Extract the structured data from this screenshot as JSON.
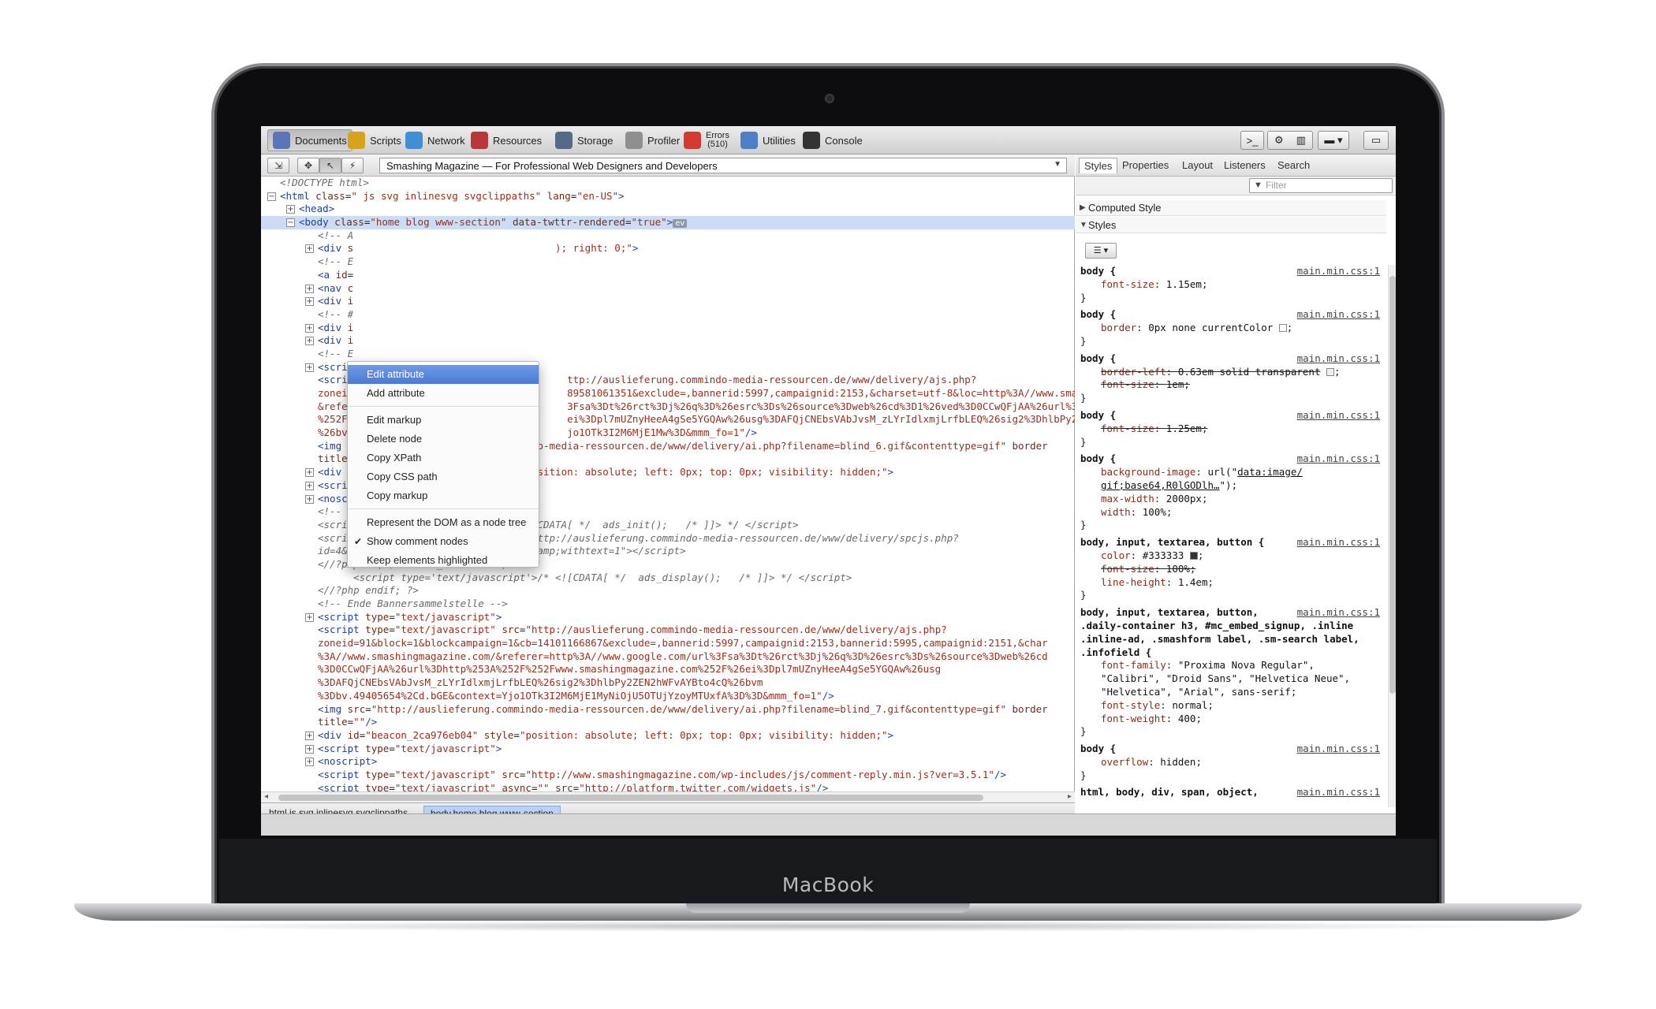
{
  "device": {
    "brand_label": "MacBook"
  },
  "toolbar": {
    "items": [
      {
        "label": "Documents",
        "icon": "documents-icon",
        "color": "#5b76b8"
      },
      {
        "label": "Scripts",
        "icon": "scripts-icon",
        "color": "#d9a21d"
      },
      {
        "label": "Network",
        "icon": "network-icon",
        "color": "#3f8fd6"
      },
      {
        "label": "Resources",
        "icon": "resources-icon",
        "color": "#b9373a"
      },
      {
        "label": "Storage",
        "icon": "storage-icon",
        "color": "#556b85"
      },
      {
        "label": "Profiler",
        "icon": "profiler-icon",
        "color": "#8f8f8f"
      },
      {
        "label": "Errors",
        "icon": "errors-icon",
        "color": "#d23b2e",
        "count": "(510)"
      },
      {
        "label": "Utilities",
        "icon": "utilities-icon",
        "color": "#4d7fc7"
      },
      {
        "label": "Console",
        "icon": "console-icon",
        "color": "#333333"
      }
    ],
    "right_buttons": [
      "console-prompt-icon",
      "gear-icon",
      "panel-dock-icon",
      "window-menu-icon",
      "layout-icon"
    ]
  },
  "subbar": {
    "document_title": "Smashing Magazine — For Professional Web Designers and Developers"
  },
  "context_menu": {
    "items": [
      {
        "label": "Edit attribute",
        "highlighted": true
      },
      {
        "label": "Add attribute"
      },
      {
        "separator": true
      },
      {
        "label": "Edit markup"
      },
      {
        "label": "Delete node"
      },
      {
        "label": "Copy XPath"
      },
      {
        "label": "Copy CSS path"
      },
      {
        "label": "Copy markup"
      },
      {
        "separator": true
      },
      {
        "label": "Represent the DOM as a node tree"
      },
      {
        "label": "Show comment nodes",
        "checked": true
      },
      {
        "label": "Keep elements highlighted"
      }
    ]
  },
  "dom_lines": [
    {
      "indent": 0,
      "toggle": "",
      "html": "<span class=\"cm\">&lt;!DOCTYPE html&gt;</span>"
    },
    {
      "indent": 0,
      "toggle": "−",
      "html": "<span class=\"tag\">&lt;html</span> <span class=\"attr\">class</span>=<span class=\"val\">\" js svg inlinesvg svgclippaths\"</span> <span class=\"attr\">lang</span>=<span class=\"val\">\"en-US\"</span><span class=\"tag\">&gt;</span>"
    },
    {
      "indent": 1,
      "toggle": "+",
      "html": "<span class=\"tag\">&lt;head&gt;</span>"
    },
    {
      "indent": 1,
      "toggle": "−",
      "sel": true,
      "html": "<span class=\"tag\">&lt;body</span> <span class=\"attr\">class</span>=<span class=\"val\">\"home blog www-section\"</span> <span class=\"attr\">data-twttr-rendered</span>=<span class=\"val\">\"true\"</span><span class=\"tag\">&gt;</span><span class=\"ev\">ev</span>"
    },
    {
      "indent": 2,
      "toggle": "",
      "html": "<span class=\"cm\">&lt;!-- A</span>"
    },
    {
      "indent": 2,
      "toggle": "+",
      "html": "<span class=\"tag\">&lt;div</span> <span class=\"attr\">s</span>                                  <span class=\"val\">); right: 0;\"</span><span class=\"tag\">&gt;</span>"
    },
    {
      "indent": 2,
      "toggle": "",
      "html": "<span class=\"cm\">&lt;!-- E</span>"
    },
    {
      "indent": 2,
      "toggle": "",
      "html": "<span class=\"tag\">&lt;a</span> <span class=\"attr\">id</span>="
    },
    {
      "indent": 2,
      "toggle": "+",
      "html": "<span class=\"tag\">&lt;nav</span> <span class=\"attr\">c</span>"
    },
    {
      "indent": 2,
      "toggle": "+",
      "html": "<span class=\"tag\">&lt;div</span> <span class=\"attr\">i</span>"
    },
    {
      "indent": 2,
      "toggle": "",
      "html": "<span class=\"cm\">&lt;!-- #</span>"
    },
    {
      "indent": 2,
      "toggle": "+",
      "html": "<span class=\"tag\">&lt;div</span> <span class=\"attr\">i</span>"
    },
    {
      "indent": 2,
      "toggle": "+",
      "html": "<span class=\"tag\">&lt;div</span> <span class=\"attr\">i</span>"
    },
    {
      "indent": 2,
      "toggle": "",
      "html": "<span class=\"cm\">&lt;!-- E</span>"
    },
    {
      "indent": 2,
      "toggle": "+",
      "html": "<span class=\"tag\">&lt;scrip</span>"
    },
    {
      "indent": 2,
      "toggle": "",
      "html": "<span class=\"tag\">&lt;scrip</span>                                    <span class=\"val\">ttp://auslieferung.commindo-media-ressourcen.de/www/delivery/ajs.php?</span>"
    },
    {
      "indent": 2,
      "toggle": "",
      "html": "<span class=\"val\">zoneid</span>                                    <span class=\"val\">89581061351&amp;exclude=,bannerid:5997,campaignid:2153,&amp;charset=utf-8&amp;loc=http%3A//www.sma</span>"
    },
    {
      "indent": 2,
      "toggle": "",
      "html": "<span class=\"val\">&amp;refer</span>                                    <span class=\"val\">3Fsa%3Dt%26rct%3Dj%26q%3D%26esrc%3Ds%26source%3Dweb%26cd%3D1%26ved%3D0CCwQFjAA%26url%3</span>"
    },
    {
      "indent": 2,
      "toggle": "",
      "html": "<span class=\"val\">%252Fw</span>                                    <span class=\"val\">ei%3Dpl7mUZnyHeeA4gSe5YGQAw%26usg%3DAFQjCNEbsVAbJvsM_zLYrIdlxmjLrfbLEQ%26sig2%3DhlbPy2</span>"
    },
    {
      "indent": 2,
      "toggle": "",
      "html": "<span class=\"val\">%26bvm</span>                                    <span class=\"val\">jo1OTk3I2M6MjE1Mw%3D&amp;mmm_fo=1\"</span><span class=\"tag\">/&gt;</span>"
    },
    {
      "indent": 2,
      "toggle": "",
      "html": "<span class=\"tag\">&lt;img</span> <span class=\"attr\">src</span>=<span class=\"val\">\"http://auslieferung.commindo-media-ressourcen.de/www/delivery/ai.php?filename=blind_6.gif&amp;contenttype=gif\"</span> <span class=\"attr\">border</span>"
    },
    {
      "indent": 2,
      "toggle": "",
      "html": "<span class=\"attr\">title</span>=<span class=\"val\">\"\"</span><span class=\"tag\">/&gt;</span>"
    },
    {
      "indent": 2,
      "toggle": "+",
      "html": "<span class=\"tag\">&lt;div</span> <span class=\"attr\">id</span>=<span class=\"val\">\"beacon_d1034e6207\"</span> <span class=\"attr\">style</span>=<span class=\"val\">\"position: absolute; left: 0px; top: 0px; visibility: hidden;\"</span><span class=\"tag\">&gt;</span>"
    },
    {
      "indent": 2,
      "toggle": "+",
      "html": "<span class=\"tag\">&lt;script</span> <span class=\"attr\">type</span>=<span class=\"val\">\"text/javascript\"</span><span class=\"tag\">&gt;</span>"
    },
    {
      "indent": 2,
      "toggle": "+",
      "html": "<span class=\"tag\">&lt;noscript&gt;</span>"
    },
    {
      "indent": 2,
      "toggle": "",
      "html": "<span class=\"cm\">&lt;!-- Anfang Bannersammelstelle</span>"
    },
    {
      "indent": 2,
      "toggle": "",
      "html": "<span class=\"cm\">&lt;script type='text/javascript'&gt;/* &lt;![CDATA[ */  ads_init();   /* ]]&gt; */ &lt;/script&gt;</span>"
    },
    {
      "indent": 2,
      "toggle": "",
      "html": "<span class=\"cm\">&lt;script type='text/javascript' src=\"http://auslieferung.commindo-media-ressourcen.de/www/delivery/spcjs.php?</span>"
    },
    {
      "indent": 2,
      "toggle": "",
      "html": "<span class=\"cm\">id=4&amp;amp;block=1&amp;amp;blockcampaign=1&amp;amp;withtext=1\"&gt;&lt;/script&gt;</span>"
    },
    {
      "indent": 2,
      "toggle": "",
      "html": "<span class=\"cm\">&lt;//?php if(!$disable_sidebarads): ?&gt;</span>"
    },
    {
      "indent": 2,
      "toggle": "",
      "html": "<span class=\"cm\">      &lt;script type='text/javascript'&gt;/* &lt;![CDATA[ */  ads_display();   /* ]]&gt; */ &lt;/script&gt;</span>"
    },
    {
      "indent": 2,
      "toggle": "",
      "html": "<span class=\"cm\">&lt;//?php endif; ?&gt;</span>"
    },
    {
      "indent": 2,
      "toggle": "",
      "html": "<span class=\"cm\">&lt;!-- Ende Bannersammelstelle --&gt;</span>"
    },
    {
      "indent": 2,
      "toggle": "+",
      "html": "<span class=\"tag\">&lt;script</span> <span class=\"attr\">type</span>=<span class=\"val\">\"text/javascript\"</span><span class=\"tag\">&gt;</span>"
    },
    {
      "indent": 2,
      "toggle": "",
      "html": "<span class=\"tag\">&lt;script</span> <span class=\"attr\">type</span>=<span class=\"val\">\"text/javascript\"</span> <span class=\"attr\">src</span>=<span class=\"val\">\"http://auslieferung.commindo-media-ressourcen.de/www/delivery/ajs.php?</span>"
    },
    {
      "indent": 2,
      "toggle": "",
      "html": "<span class=\"val\">zoneid=91&amp;block=1&amp;blockcampaign=1&amp;cb=14101166867&amp;exclude=,bannerid:5997,campaignid:2153,bannerid:5995,campaignid:2151,&amp;char</span>"
    },
    {
      "indent": 2,
      "toggle": "",
      "html": "<span class=\"val\">%3A//www.smashingmagazine.com/&amp;referer=http%3A//www.google.com/url%3Fsa%3Dt%26rct%3Dj%26q%3D%26esrc%3Ds%26source%3Dweb%26cd</span>"
    },
    {
      "indent": 2,
      "toggle": "",
      "html": "<span class=\"val\">%3D0CCwQFjAA%26url%3Dhttp%253A%252F%252Fwww.smashingmagazine.com%252F%26ei%3Dpl7mUZnyHeeA4gSe5YGQAw%26usg</span>"
    },
    {
      "indent": 2,
      "toggle": "",
      "html": "<span class=\"val\">%3DAFQjCNEbsVAbJvsM_zLYrIdlxmjLrfbLEQ%26sig2%3DhlbPy2ZEN2hWFvAYBto4cQ%26bvm</span>"
    },
    {
      "indent": 2,
      "toggle": "",
      "html": "<span class=\"val\">%3Dbv.49405654%2Cd.bGE&amp;context=Yjo1OTk3I2M6MjE1MyNiOjU5OTUjYzoyMTUxfA%3D%3D&amp;mmm_fo=1\"</span><span class=\"tag\">/&gt;</span>"
    },
    {
      "indent": 2,
      "toggle": "",
      "html": "<span class=\"tag\">&lt;img</span> <span class=\"attr\">src</span>=<span class=\"val\">\"http://auslieferung.commindo-media-ressourcen.de/www/delivery/ai.php?filename=blind_7.gif&amp;contenttype=gif\"</span> <span class=\"attr\">border</span>"
    },
    {
      "indent": 2,
      "toggle": "",
      "html": "<span class=\"attr\">title</span>=<span class=\"val\">\"\"</span><span class=\"tag\">/&gt;</span>"
    },
    {
      "indent": 2,
      "toggle": "+",
      "html": "<span class=\"tag\">&lt;div</span> <span class=\"attr\">id</span>=<span class=\"val\">\"beacon_2ca976eb04\"</span> <span class=\"attr\">style</span>=<span class=\"val\">\"position: absolute; left: 0px; top: 0px; visibility: hidden;\"</span><span class=\"tag\">&gt;</span>"
    },
    {
      "indent": 2,
      "toggle": "+",
      "html": "<span class=\"tag\">&lt;script</span> <span class=\"attr\">type</span>=<span class=\"val\">\"text/javascript\"</span><span class=\"tag\">&gt;</span>"
    },
    {
      "indent": 2,
      "toggle": "+",
      "html": "<span class=\"tag\">&lt;noscript&gt;</span>"
    },
    {
      "indent": 2,
      "toggle": "",
      "html": "<span class=\"tag\">&lt;script</span> <span class=\"attr\">type</span>=<span class=\"val\">\"text/javascript\"</span> <span class=\"attr\">src</span>=<span class=\"val\">\"http://www.smashingmagazine.com/wp-includes/js/comment-reply.min.js?ver=3.5.1\"</span><span class=\"tag\">/&gt;</span>"
    },
    {
      "indent": 2,
      "toggle": "",
      "html": "<span class=\"tag\">&lt;script</span> <span class=\"attr\">type</span>=<span class=\"val\">\"text/javascript\"</span> <span class=\"attr\">async</span>=<span class=\"val\">\"\"</span> <span class=\"attr\">src</span>=<span class=\"val\">\"http://platform.twitter.com/widgets.js\"</span><span class=\"tag\">/&gt;</span>"
    }
  ],
  "breadcrumb": {
    "items": [
      {
        "label": "html.js.svg.inlinesvg.svgclippaths",
        "active": false
      },
      {
        "label": "body.home.blog.www-section",
        "active": true
      }
    ]
  },
  "sidebar": {
    "tabs": [
      "Styles",
      "Properties",
      "Layout",
      "Listeners",
      "Search"
    ],
    "active_tab": "Styles",
    "filter_placeholder": "Filter",
    "computed_style_label": "Computed Style",
    "styles_label": "Styles",
    "rules": [
      {
        "selector": "body {",
        "source": "main.min.css:1",
        "decls": [
          {
            "html": "<span class=\"pn\">font-size</span>: <span class=\"pv\">1.15em</span>;"
          }
        ]
      },
      {
        "selector": "body {",
        "source": "main.min.css:1",
        "decls": [
          {
            "html": "<span class=\"pn\">border</span>: <span class=\"pv\">0px none currentColor</span> <span class=\"swatch\" style=\"background:#fff\"></span>;"
          }
        ]
      },
      {
        "selector": "body {",
        "source": "main.min.css:1",
        "decls": [
          {
            "html": "<span class=\"strike\"><span class=\"pn\">border-left</span>: <span class=\"pv\">0.63em solid transparent</span></span> <span class=\"swatch\" style=\"background:#eee\"></span>;"
          },
          {
            "html": "<span class=\"strike\"><span class=\"pn\">font-size</span>: <span class=\"pv\">1em</span>;</span>"
          }
        ]
      },
      {
        "selector": "body {",
        "source": "main.min.css:1",
        "decls": [
          {
            "html": "<span class=\"strike\"><span class=\"pn\">font-size</span>: <span class=\"pv\">1.25em</span>;</span>"
          }
        ]
      },
      {
        "selector": "body {",
        "source": "main.min.css:1",
        "decls": [
          {
            "html": "<span class=\"pn\">background-image</span>: <span class=\"pv\">url(\"<u>data:image/</u></span>"
          },
          {
            "html": "<span class=\"pv\"><u>gif;base64,R0lGODlh…</u>\");</span>"
          },
          {
            "html": "<span class=\"pn\">max-width</span>: <span class=\"pv\">2000px</span>;"
          },
          {
            "html": "<span class=\"pn\">width</span>: <span class=\"pv\">100%</span>;"
          }
        ]
      },
      {
        "selector": "body, input, textarea, button {",
        "source": "main.min.css:1",
        "decls": [
          {
            "html": "<span class=\"pn\">color</span>: <span class=\"pv\">#333333</span> <span class=\"swatch\" style=\"background:#333\"></span>;"
          },
          {
            "html": "<span class=\"strike\"><span class=\"pn\">font-size</span>: <span class=\"pv\">100%</span>;</span>"
          },
          {
            "html": "<span class=\"pn\">line-height</span>: <span class=\"pv\">1.4em</span>;"
          }
        ]
      },
      {
        "selector": "body, input, textarea, button,\n.daily-container h3, #mc_embed_signup, .inline\n.inline-ad, .smashform label, .sm-search label,\n.infofield {",
        "source": "main.min.css:1",
        "decls": [
          {
            "html": "<span class=\"pn\">font-family</span>: <span class=\"pv\">\"Proxima Nova Regular\",</span>"
          },
          {
            "html": "<span class=\"pv\">\"Calibri\", \"Droid Sans\", \"Helvetica Neue\",</span>"
          },
          {
            "html": "<span class=\"pv\">\"Helvetica\", \"Arial\", sans-serif</span>;"
          },
          {
            "html": "<span class=\"pn\">font-style</span>: <span class=\"pv\">normal</span>;"
          },
          {
            "html": "<span class=\"pn\">font-weight</span>: <span class=\"pv\">400</span>;"
          }
        ]
      },
      {
        "selector": "body {",
        "source": "main.min.css:1",
        "decls": [
          {
            "html": "<span class=\"pn\">overflow</span>: <span class=\"pv\">hidden</span>;"
          }
        ]
      },
      {
        "selector": "html, body, div, span, object,",
        "source": "main.min.css:1",
        "decls": []
      }
    ]
  }
}
